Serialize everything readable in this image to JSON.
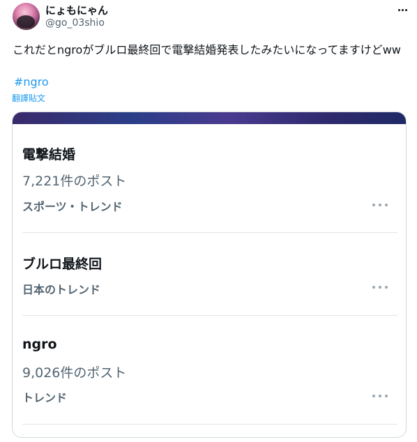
{
  "tweet": {
    "display_name": "にょもにゃん",
    "handle": "@go_03shio",
    "text": "これだとngroがブルロ最終回で電撃結婚発表したみたいになってますけどww",
    "hashtag": "#ngro",
    "translate_label": "翻譯貼文"
  },
  "trends": [
    {
      "title": "電撃結婚",
      "count": "7,221件のポスト",
      "category": "スポーツ・トレンド"
    },
    {
      "title": "ブルロ最終回",
      "count": "",
      "category": "日本のトレンド"
    },
    {
      "title": "ngro",
      "count": "9,026件のポスト",
      "category": "トレンド"
    }
  ],
  "icons": {
    "more": "more-horizontal-icon",
    "avatar": "profile-avatar"
  },
  "colors": {
    "link": "#1d9bf0",
    "secondary": "#536471",
    "primary": "#0f1419",
    "border": "#cfd9de"
  }
}
